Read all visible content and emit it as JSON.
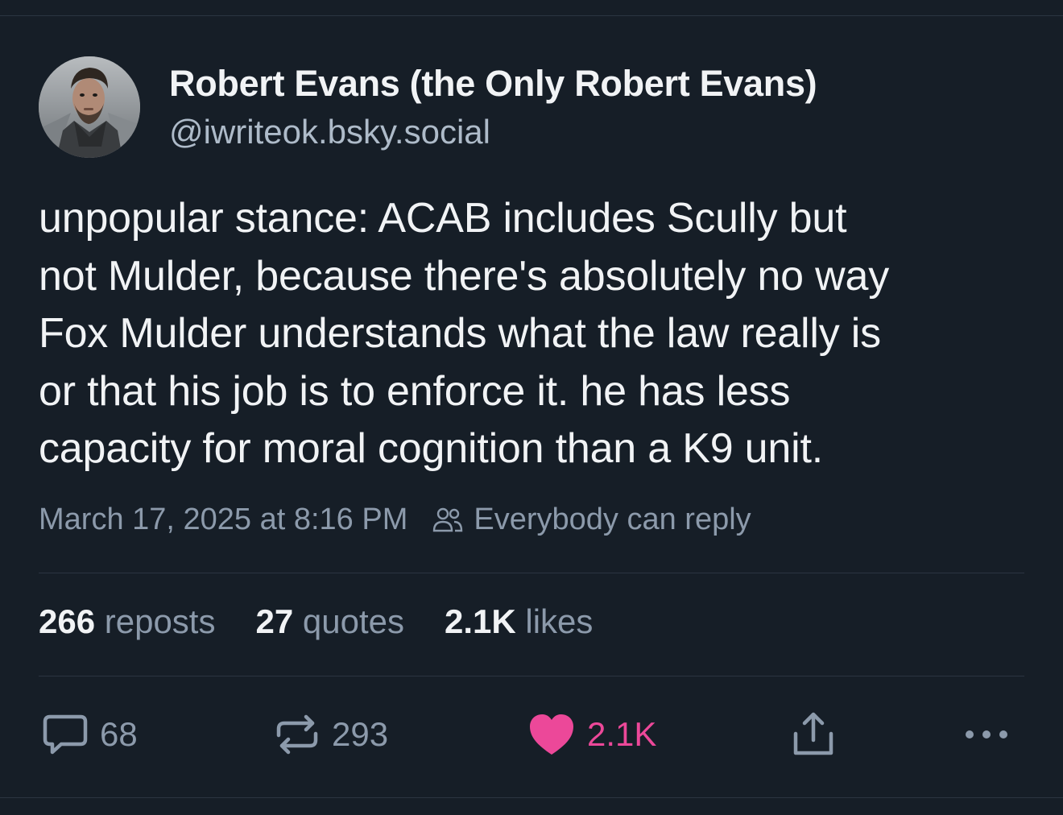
{
  "post": {
    "author_name": "Robert Evans (the Only Robert Evans)",
    "author_handle": "@iwriteok.bsky.social",
    "text_lines": [
      "unpopular stance: ACAB includes Scully but",
      "not Mulder, because there's absolutely no way",
      "Fox Mulder understands what the law really is",
      "or that his job is to enforce it. he has less",
      "capacity for moral cognition than a K9 unit."
    ],
    "timestamp": "March 17, 2025 at 8:16 PM",
    "reply_setting": "Everybody can reply"
  },
  "stats": {
    "reposts_count": "266",
    "reposts_label": "reposts",
    "quotes_count": "27",
    "quotes_label": "quotes",
    "likes_count": "2.1K",
    "likes_label": "likes"
  },
  "actions": {
    "reply_count": "68",
    "repost_count": "293",
    "like_count": "2.1K",
    "liked": true
  },
  "icons": {
    "reply": "reply-icon",
    "repost": "repost-icon",
    "like": "heart-icon",
    "share": "share-icon",
    "more": "more-icon",
    "audience": "people-icon"
  },
  "colors": {
    "background": "#161e27",
    "text": "#f1f3f5",
    "muted": "#8c9aab",
    "like": "#ec4899"
  }
}
